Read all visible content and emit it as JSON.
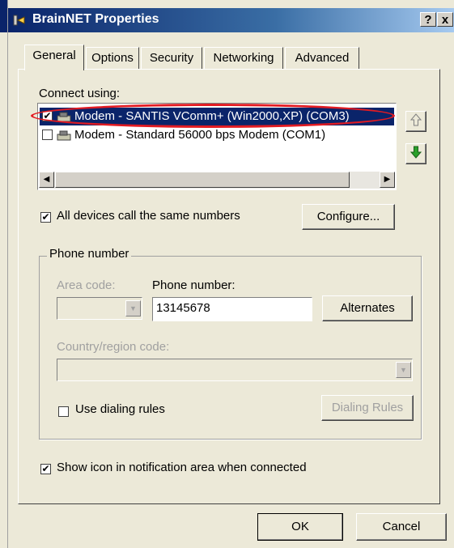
{
  "window": {
    "title": "BrainNET Properties",
    "help_label": "?",
    "close_label": "x"
  },
  "tabs": [
    {
      "label": "General"
    },
    {
      "label": "Options"
    },
    {
      "label": "Security"
    },
    {
      "label": "Networking"
    },
    {
      "label": "Advanced"
    }
  ],
  "connect": {
    "label": "Connect using:",
    "devices": [
      {
        "label": "Modem - SANTIS VComm+ (Win2000,XP) (COM3)",
        "checked": true,
        "selected": true
      },
      {
        "label": "Modem - Standard 56000 bps Modem (COM1)",
        "checked": false,
        "selected": false
      }
    ]
  },
  "all_devices": {
    "label": "All devices call the same numbers",
    "checked": true
  },
  "configure_label": "Configure...",
  "phone_group": {
    "title": "Phone number",
    "area_code_label": "Area code:",
    "area_code_value": "",
    "phone_label": "Phone number:",
    "phone_value": "13145678",
    "alternates_label": "Alternates",
    "country_label": "Country/region code:",
    "country_value": "",
    "dialing_rules_label": "Use dialing rules",
    "dialing_rules_checked": false,
    "dialing_rules_button": "Dialing Rules"
  },
  "show_icon": {
    "label": "Show icon in notification area when connected",
    "checked": true
  },
  "footer": {
    "ok_label": "OK",
    "cancel_label": "Cancel"
  },
  "colors": {
    "selection": "#0a246a",
    "highlight_ring": "#e21b22",
    "dialog": "#ece9d8"
  }
}
